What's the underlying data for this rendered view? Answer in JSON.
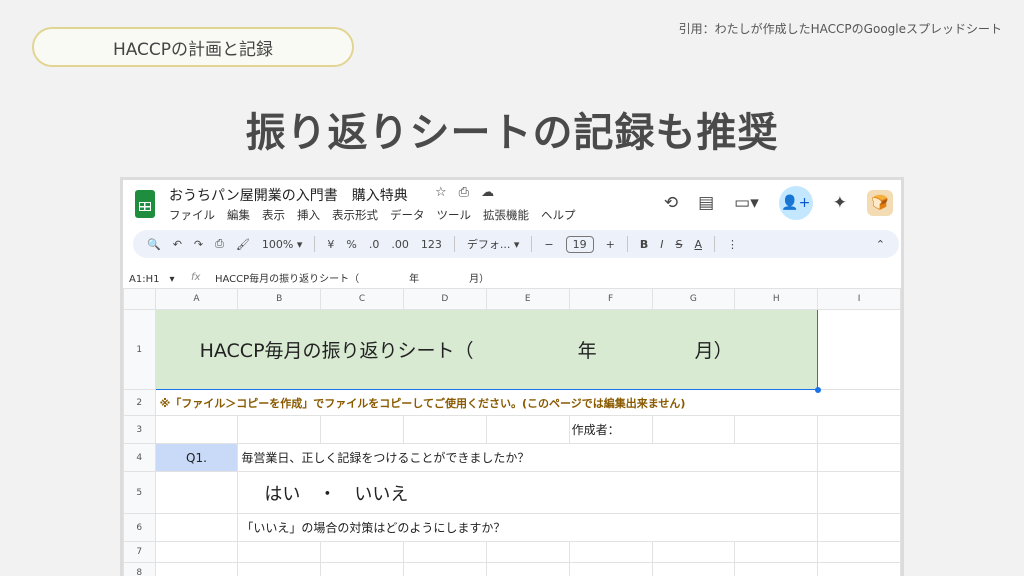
{
  "slide": {
    "pill_label": "HACCPの計画と記録",
    "citation": "引用：わたしが作成したHACCPのGoogleスプレッドシート",
    "headline": "振り返りシートの記録も推奨"
  },
  "window": {
    "doc_title": "おうちパン屋開業の入門書　購入特典",
    "title_icons": [
      "☆",
      "📁",
      "☁"
    ],
    "menu": [
      "ファイル",
      "編集",
      "表示",
      "挿入",
      "表示形式",
      "データ",
      "ツール",
      "拡張機能",
      "ヘルプ"
    ],
    "right_icons": [
      "history-icon",
      "comment-icon",
      "video-call-icon",
      "share-icon",
      "gemini-icon",
      "avatar"
    ]
  },
  "toolbar": {
    "zoom": "100%",
    "currency": "¥",
    "percent": "%",
    "dec_decrease": ".0",
    "dec_increase": ".00",
    "number_format": "123",
    "font": "デフォ...",
    "minus": "−",
    "font_size": "19",
    "plus": "+",
    "bold": "B",
    "italic": "I",
    "strike": "S",
    "text_color": "A",
    "more": "⋮",
    "collapse": "⌃"
  },
  "formula_bar": {
    "namebox": "A1:H1",
    "fx": "fx",
    "content": "HACCP毎月の振り返りシート（　　　　　年　　　　　月）"
  },
  "columns": [
    "A",
    "B",
    "C",
    "D",
    "E",
    "F",
    "G",
    "H",
    "I"
  ],
  "rows": [
    "1",
    "2",
    "3",
    "4",
    "5",
    "6",
    "7",
    "8"
  ],
  "cells": {
    "r1_title": "HACCP毎月の振り返りシート（",
    "r1_year": "年",
    "r1_month": "月）",
    "r2_note": "※「ファイル＞コピーを作成」でファイルをコピーしてご使用ください。(このページでは編集出来ません)",
    "r3_author": "作成者：",
    "r4_q": "Q1.",
    "r4_question": "毎営業日、正しく記録をつけることができましたか？",
    "r5_answer": "はい　・　いいえ",
    "r6_followup": "「いいえ」の場合の対策はどのようにしますか？"
  },
  "colors": {
    "title_fill": "#d9ead3",
    "q_fill": "#c9daf8",
    "note_text": "#8a5a00",
    "selection": "#1a73e8",
    "pill_border": "#e2d594"
  }
}
